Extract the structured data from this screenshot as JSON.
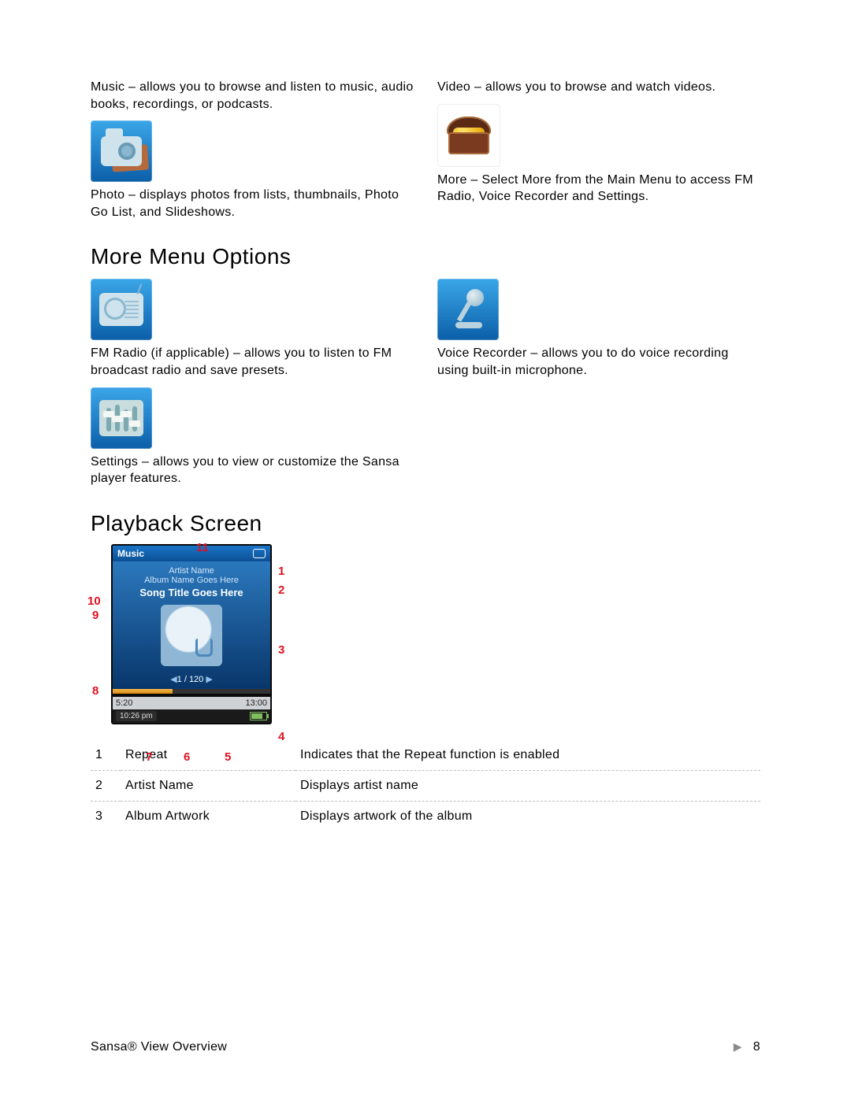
{
  "top": {
    "left": [
      {
        "term": "Music",
        "desc": " – allows you to browse and listen to music, audio books, recordings, or podcasts."
      },
      {
        "icon": "camera",
        "term": "Photo",
        "desc": " – displays photos from lists, thumbnails, Photo Go List, and Slideshows."
      }
    ],
    "right": [
      {
        "term": "Video",
        "desc": " – allows you to browse and watch videos."
      },
      {
        "icon": "chest",
        "term": "More",
        "desc": " – Select More from the Main Menu to access FM Radio, Voice Recorder and Settings."
      }
    ]
  },
  "sections": {
    "more_menu": "More Menu Options",
    "playback": "Playback Screen"
  },
  "more": {
    "left": [
      {
        "icon": "radio",
        "term": "FM Radio",
        "term_suffix": " (if applicable)",
        "desc": " – allows you to listen to FM broadcast radio and save presets."
      },
      {
        "icon": "sliders",
        "term": "Settings",
        "desc": " – allows you to view or customize the Sansa player features."
      }
    ],
    "right": [
      {
        "icon": "mic",
        "term": "Voice Recorder",
        "desc": " – allows you to do voice recording using built-in microphone."
      }
    ]
  },
  "playback": {
    "header": "Music",
    "artist": "Artist Name",
    "album": "Album Name Goes Here",
    "song": "Song Title Goes Here",
    "counter": "1 / 120",
    "elapsed": "5:20",
    "total": "13:00",
    "clock": "10:26 pm",
    "callouts": {
      "c1": "1",
      "c2": "2",
      "c3": "3",
      "c4": "4",
      "c5": "5",
      "c6": "6",
      "c7": "7",
      "c8": "8",
      "c9": "9",
      "c10": "10",
      "c11": "11"
    }
  },
  "legend": [
    {
      "n": "1",
      "k": "Repeat",
      "v": "Indicates that the Repeat function is enabled"
    },
    {
      "n": "2",
      "k": "Artist Name",
      "v": "Displays artist name"
    },
    {
      "n": "3",
      "k": "Album Artwork",
      "v": "Displays artwork of the album"
    }
  ],
  "footer": {
    "left": "Sansa®  View Overview",
    "page": "8"
  }
}
